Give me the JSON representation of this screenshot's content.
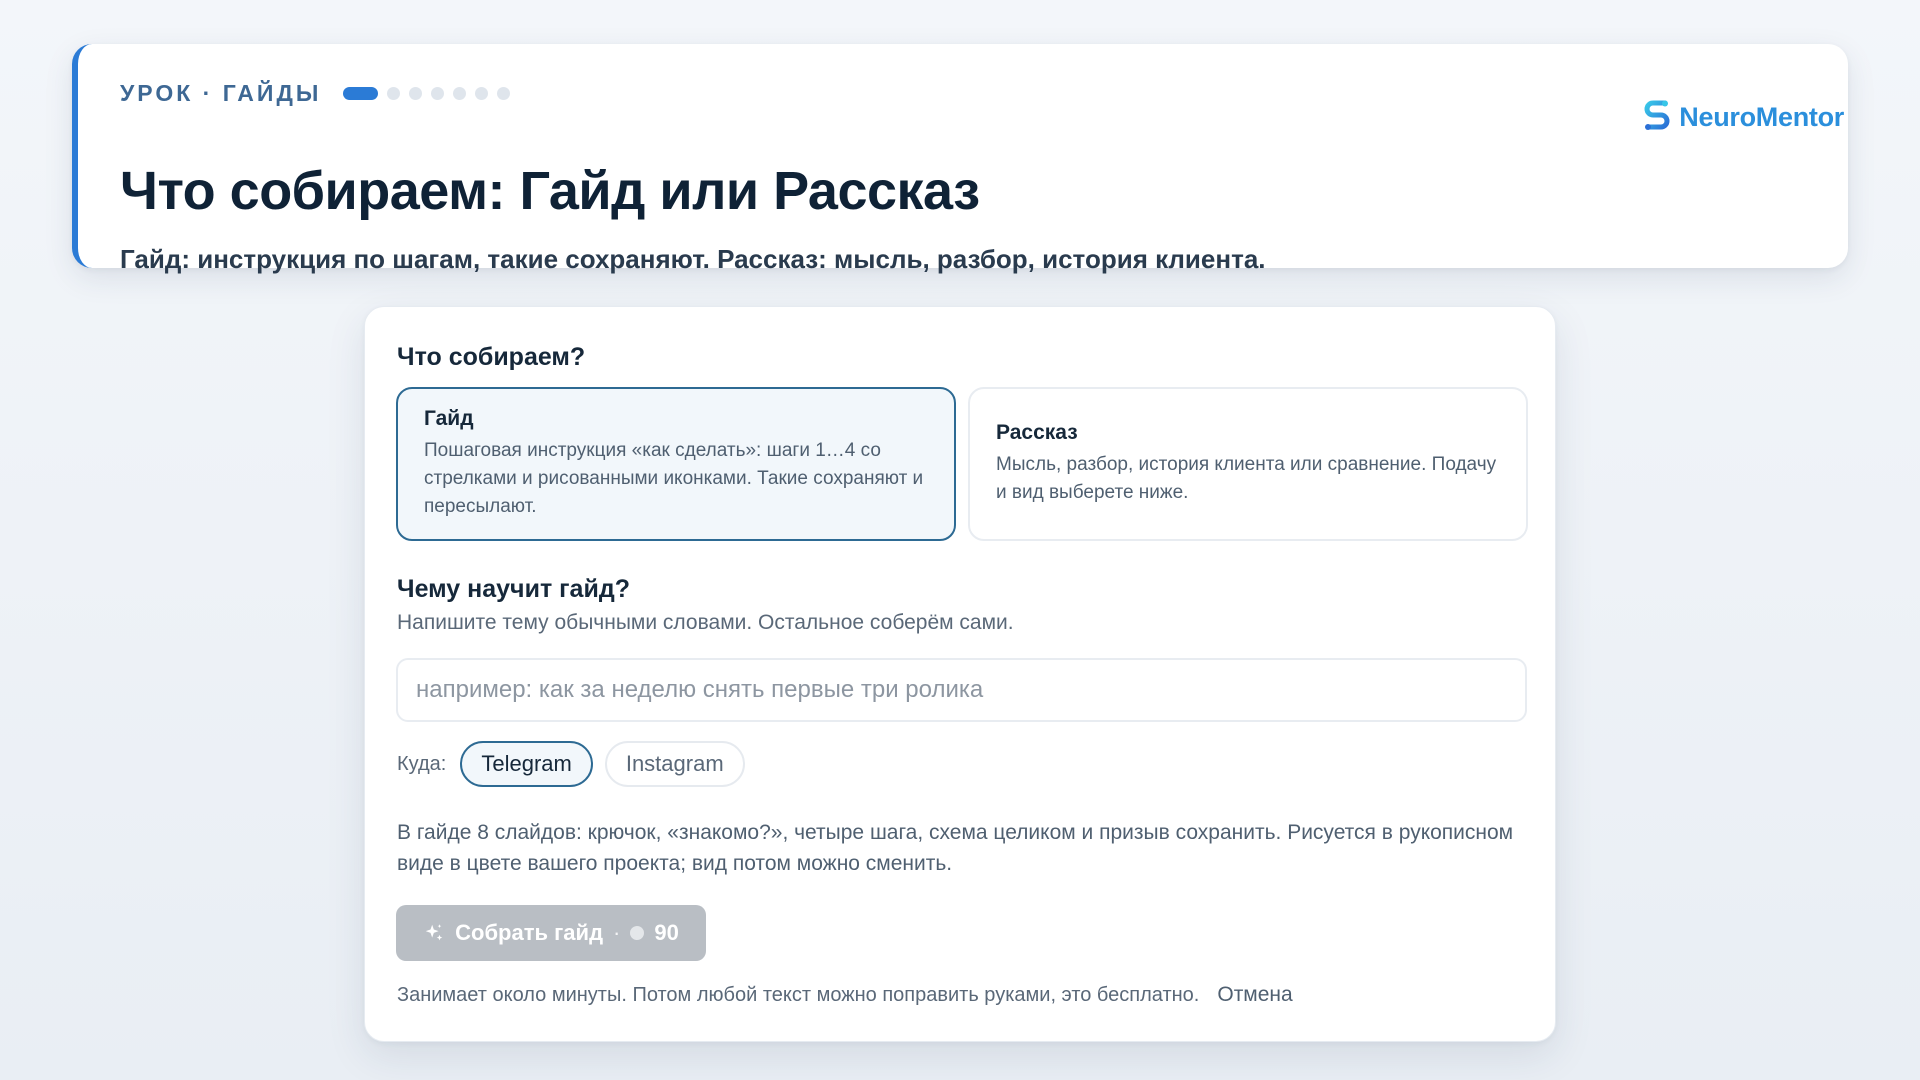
{
  "header": {
    "eyebrow": "УРОК · ГАЙДЫ",
    "progress": {
      "current": 1,
      "total": 8
    },
    "title": "Что собираем: Гайд или Рассказ",
    "subtitle": "Гайд: инструкция по шагам, такие сохраняют. Рассказ: мысль, разбор, история клиента.",
    "logo_text": "NeuroMentor",
    "brand_color": "#2b8fdc"
  },
  "form": {
    "question_type": "Что собираем?",
    "options": [
      {
        "title": "Гайд",
        "description": "Пошаговая инструкция «как сделать»: шаги 1…4 со стрелками и рисованными иконками. Такие сохраняют и пересылают.",
        "selected": true
      },
      {
        "title": "Рассказ",
        "description": "Мысль, разбор, история клиента или сравнение. Подачу и вид выберете ниже.",
        "selected": false
      }
    ],
    "question_topic": "Чему научит гайд?",
    "topic_hint": "Напишите тему обычными словами. Остальное соберём сами.",
    "topic_placeholder": "например: как за неделю снять первые три ролика",
    "topic_value": "",
    "destination_label": "Куда:",
    "destinations": [
      {
        "label": "Telegram",
        "selected": true
      },
      {
        "label": "Instagram",
        "selected": false
      }
    ],
    "description": "В гайде 8 слайдов: крючок, «знакомо?», четыре шага, схема целиком и призыв сохранить. Рисуется в рукописном виде в цвете вашего проекта; вид потом можно сменить.",
    "submit": {
      "label": "Собрать гайд",
      "separator": "·",
      "cost": "90",
      "disabled": true
    },
    "footer_note": "Занимает около минуты. Потом любой текст можно поправить руками, это бесплатно.",
    "cancel_label": "Отмена"
  },
  "colors": {
    "accent": "#2b7bd6",
    "selected_border": "#2d6a93",
    "disabled_button": "#b9bec4"
  }
}
